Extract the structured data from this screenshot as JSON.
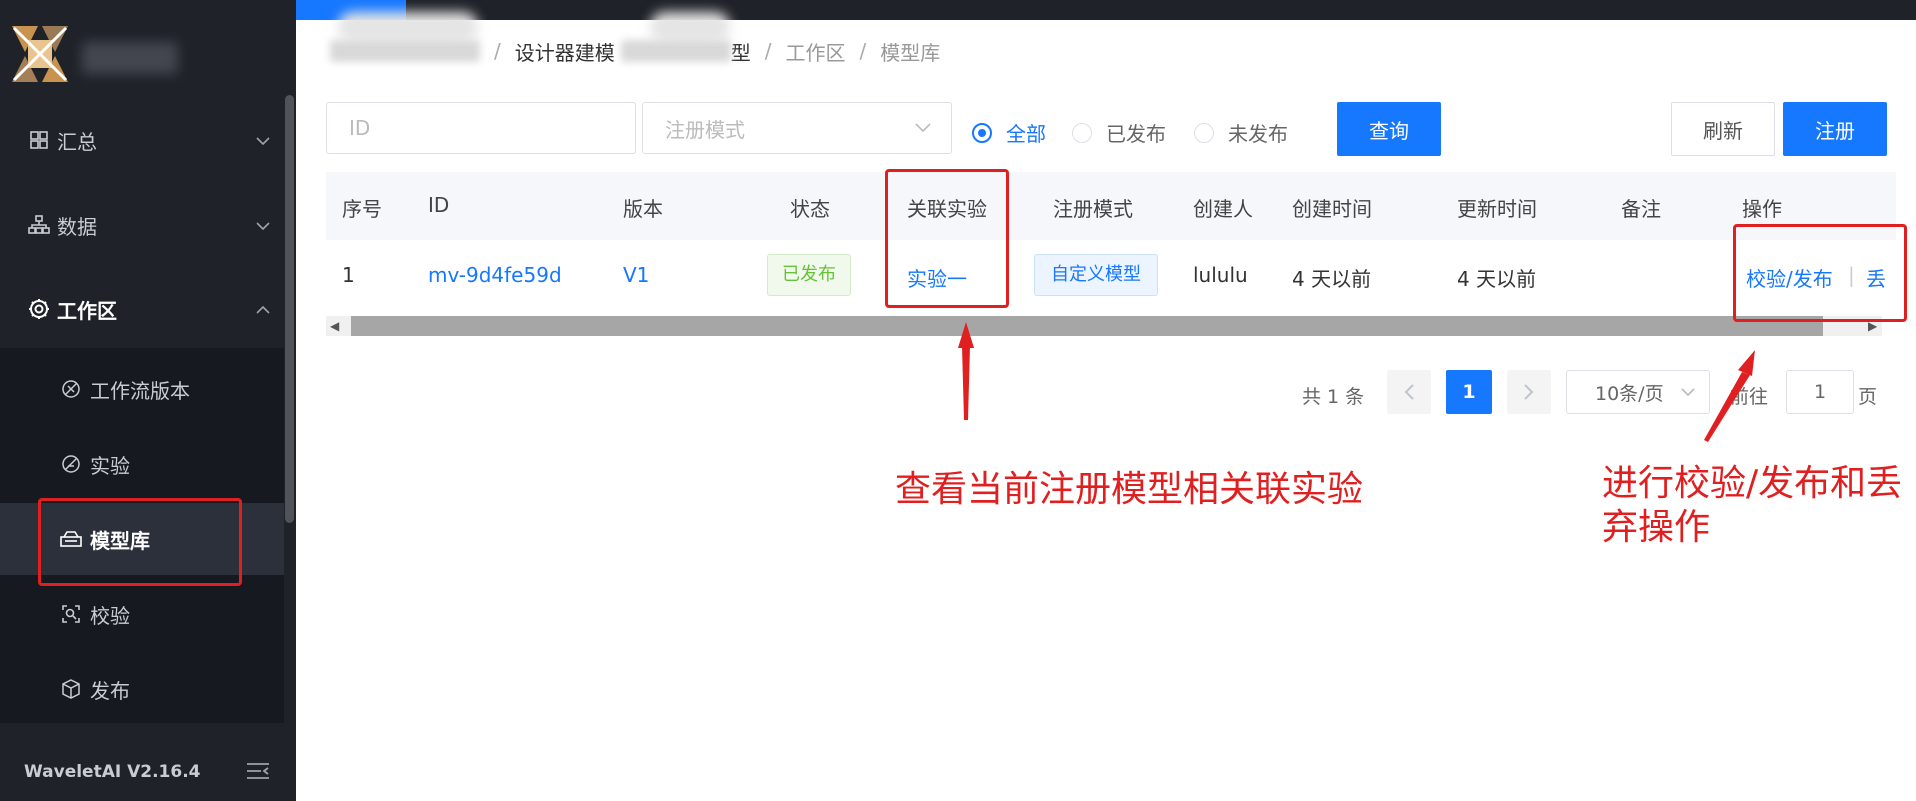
{
  "app": {
    "version": "WaveletAI V2.16.4"
  },
  "sidebar": {
    "items": [
      {
        "label": "汇总",
        "icon": "grid-icon"
      },
      {
        "label": "数据",
        "icon": "sitemap-icon"
      },
      {
        "label": "工作区",
        "icon": "gear-icon"
      }
    ],
    "sub_items": [
      {
        "label": "工作流版本",
        "icon": "workflow-icon"
      },
      {
        "label": "实验",
        "icon": "experiment-icon"
      },
      {
        "label": "模型库",
        "icon": "model-library-icon"
      },
      {
        "label": "校验",
        "icon": "scan-icon"
      },
      {
        "label": "发布",
        "icon": "cube-icon"
      }
    ]
  },
  "breadcrumb": {
    "part1": "设计器建模",
    "part2": "型",
    "workspace": "工作区",
    "current": "模型库"
  },
  "filters": {
    "id_placeholder": "ID",
    "mode_placeholder": "注册模式",
    "radio_all": "全部",
    "radio_published": "已发布",
    "radio_unpublished": "未发布",
    "query_button": "查询",
    "refresh_button": "刷新",
    "register_button": "注册"
  },
  "table": {
    "headers": [
      "序号",
      "ID",
      "版本",
      "状态",
      "关联实验",
      "注册模式",
      "创建人",
      "创建时间",
      "更新时间",
      "备注",
      "操作"
    ],
    "rows": [
      {
        "index": "1",
        "id": "mv-9d4fe59d",
        "version": "V1",
        "status": "已发布",
        "experiment": "实验一",
        "mode": "自定义模型",
        "creator": "lululu",
        "created": "4 天以前",
        "updated": "4 天以前",
        "remark": "",
        "action_verify": "校验/发布",
        "action_sep": "|",
        "action_discard": "丢"
      }
    ]
  },
  "pagination": {
    "total": "共 1 条",
    "current": "1",
    "page_size": "10条/页",
    "goto_label": "前往",
    "goto_value": "1",
    "page_suffix": "页"
  },
  "annotations": {
    "experiment_note": "查看当前注册模型相关联实验",
    "action_note_line1": "进行校验/发布和丢",
    "action_note_line2": "弃操作"
  },
  "colors": {
    "accent": "#1677ff",
    "sidebar_bg": "#1f2229",
    "annotation_red": "#e02020",
    "success_green": "#67c23a"
  }
}
